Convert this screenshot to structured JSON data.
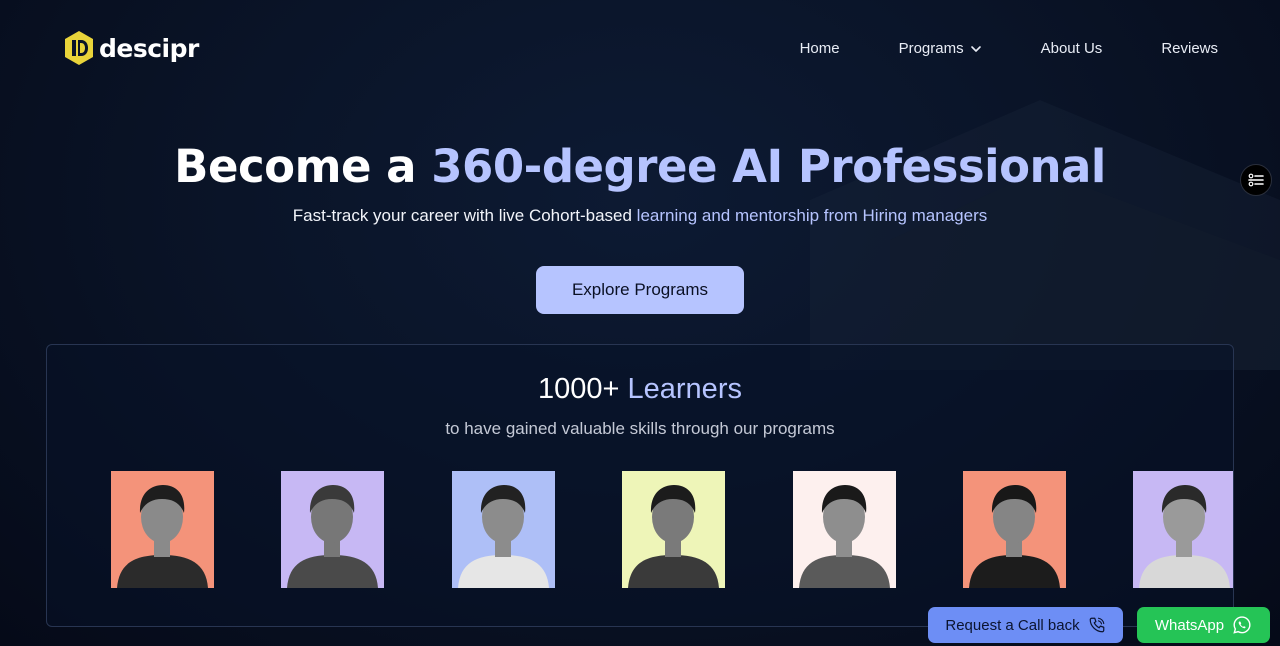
{
  "brand": {
    "name": "descipr",
    "logo_icon": "hexagon-logo-icon",
    "logo_color": "#e9d43a"
  },
  "nav": {
    "home": "Home",
    "programs": "Programs",
    "about": "About Us",
    "reviews": "Reviews"
  },
  "hero": {
    "title_prefix": "Become a ",
    "title_accent": "360-degree AI Professional",
    "subtitle_prefix": "Fast-track your career with live Cohort-based ",
    "subtitle_accent": "learning and mentorship from Hiring managers",
    "cta_label": "Explore Programs"
  },
  "learners": {
    "count": "1000+",
    "label": "Learners",
    "subtitle": "to have gained valuable skills through our programs",
    "photos": [
      {
        "bg": "#f4937a"
      },
      {
        "bg": "#c7b8f4"
      },
      {
        "bg": "#aebff7"
      },
      {
        "bg": "#eef5b8"
      },
      {
        "bg": "#fdf0ee"
      },
      {
        "bg": "#f4937a"
      },
      {
        "bg": "#c7b8f4"
      }
    ]
  },
  "floating": {
    "callback_label": "Request a Call back",
    "whatsapp_label": "WhatsApp"
  },
  "colors": {
    "accent": "#b6c4ff",
    "whatsapp": "#25c456",
    "callback": "#6d8ef5"
  }
}
